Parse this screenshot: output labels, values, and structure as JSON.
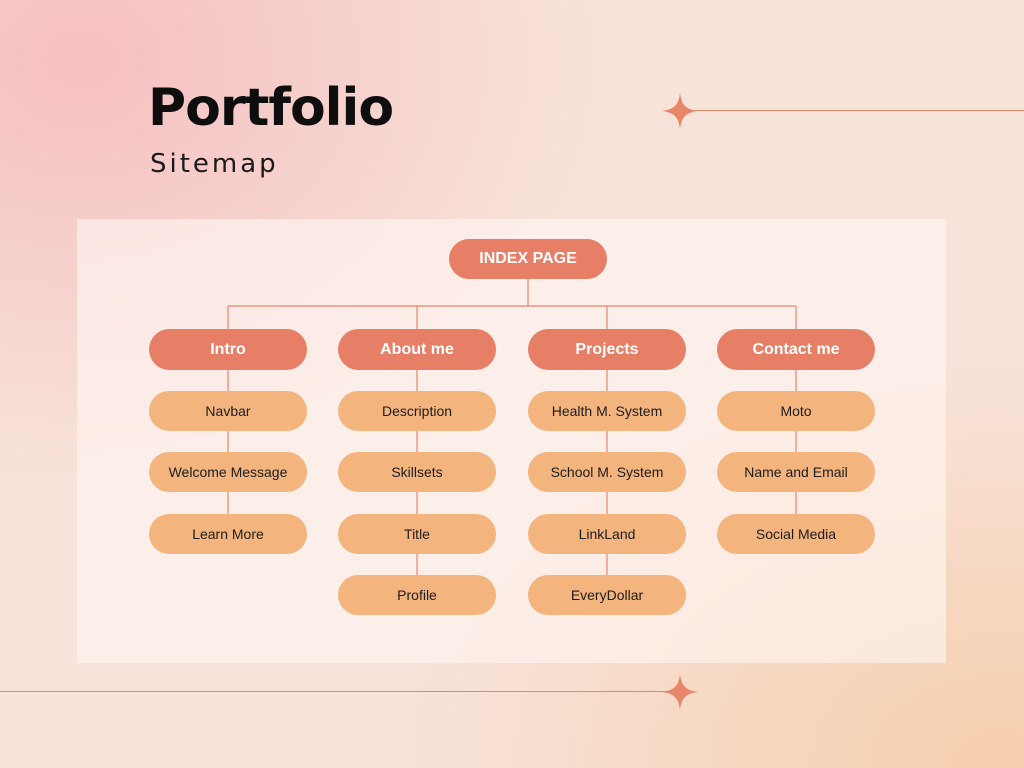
{
  "header": {
    "title": "Portfolio",
    "subtitle": "Sitemap"
  },
  "sitemap": {
    "root": "INDEX PAGE",
    "sections": [
      {
        "label": "Intro",
        "pages": [
          "Navbar",
          "Welcome Message",
          "Learn More"
        ]
      },
      {
        "label": "About me",
        "pages": [
          "Description",
          "Skillsets",
          "Title",
          "Profile"
        ]
      },
      {
        "label": "Projects",
        "pages": [
          "Health M. System",
          "School M. System",
          "LinkLand",
          "EveryDollar"
        ]
      },
      {
        "label": "Contact me",
        "pages": [
          "Moto",
          "Name and Email",
          "Social Media"
        ]
      }
    ]
  },
  "colors": {
    "accent": "#e67f66",
    "node_fill": "#f4b47e",
    "connector": "#e8866a",
    "panel": "#fbeee9"
  },
  "icons": {
    "decoration": "sparkle-icon"
  }
}
